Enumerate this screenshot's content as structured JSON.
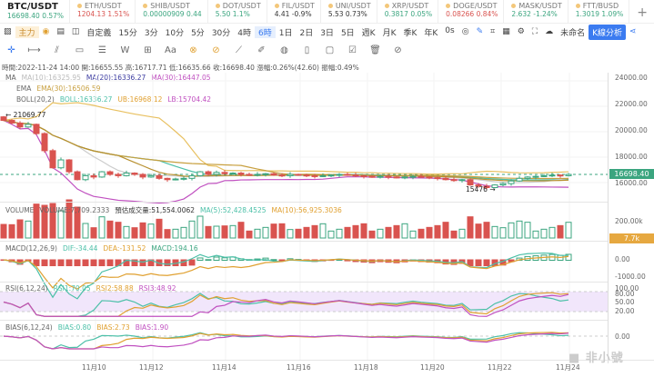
{
  "tickers": [
    {
      "name": "BTC/USDT",
      "price": "16698.40",
      "change": "0.57%",
      "color": "#3ba57f"
    },
    {
      "name": "ETH/USDT",
      "price": "1204.13",
      "change": "1.51%",
      "color": "#d9534f"
    },
    {
      "name": "SHIB/USDT",
      "price": "0.00000909",
      "change": "0.44",
      "color": "#3ba57f"
    },
    {
      "name": "DOT/USDT",
      "price": "5.50",
      "change": "1.1%",
      "color": "#3ba57f"
    },
    {
      "name": "FIL/USDT",
      "price": "4.41",
      "change": "-0.9%",
      "color": "#333"
    },
    {
      "name": "UNI/USDT",
      "price": "5.53",
      "change": "0.73%",
      "color": "#333"
    },
    {
      "name": "XRP/USDT",
      "price": "0.3817",
      "change": "0.05%",
      "color": "#3ba57f"
    },
    {
      "name": "DOGE/USDT",
      "price": "0.08266",
      "change": "0.84%",
      "color": "#d9534f"
    },
    {
      "name": "MASK/USDT",
      "price": "2.632",
      "change": "-1.24%",
      "color": "#3ba57f"
    },
    {
      "name": "FTT/BUSD",
      "price": "1.3019",
      "change": "1.09%",
      "color": "#3ba57f"
    }
  ],
  "toolbar": {
    "main": "主力",
    "custom": "自定義",
    "timeframes": [
      "15分",
      "3分",
      "10分",
      "5分",
      "30分",
      "4時",
      "6時",
      "1日",
      "2日",
      "3日",
      "5日",
      "週K",
      "月K",
      "季K",
      "年K",
      "0s"
    ],
    "active": "6時",
    "layout_name": "未命名",
    "analysis": "K線分析"
  },
  "info": "時間:2022-11-24 14:00 開:16655.55 高:16717.71 低:16635.66 收:16698.40 漲幅:0.26%(42.60) 振幅:0.49%",
  "legend": {
    "ma": {
      "label": "MA",
      "ma10": "MA(10):16325.95",
      "ma20": "MA(20):16336.27",
      "ma30": "MA(30):16447.05"
    },
    "ema": {
      "label": "EMA",
      "ema30": "EMA(30):16506.59"
    },
    "boll": {
      "label": "BOLL(20,2)",
      "boll": "BOLL:16336.27",
      "ub": "UB:16968.12",
      "lb": "LB:15704.42"
    },
    "volume": {
      "label": "VOLUME",
      "vol": "VOLUME:7,709.2333",
      "est": "預估成交量:51,554.0062",
      "ma5": "MA(5):52,428.4525",
      "ma10": "MA(10):56,925.3036"
    },
    "macd": {
      "label": "MACD(12,26,9)",
      "dif": "DIF:-34.44",
      "dea": "DEA:-131.52",
      "macd": "MACD:194.16"
    },
    "rsi": {
      "label": "RSI(6,12,24)",
      "r1": "RSI1:70.05",
      "r2": "RSI2:58.88",
      "r3": "RSI3:48.92"
    },
    "bias": {
      "label": "BIAS(6,12,24)",
      "b1": "BIAS:0.80",
      "b2": "BIAS:2.73",
      "b3": "BIAS:1.90"
    }
  },
  "price_axis": [
    "24000.00",
    "22000.00",
    "20000.00",
    "18000.00",
    "16000.00"
  ],
  "current_price": "16698.40",
  "high_marker": "21069.77",
  "low_marker": "15476",
  "volume_axis": "200.00k",
  "volume_tag": "7.7k",
  "macd_axis": [
    "0.00",
    "-1000.00"
  ],
  "rsi_axis": [
    "100.00",
    "80.00",
    "50.00",
    "20.00"
  ],
  "bias_axis": "0.00",
  "x_labels": [
    "11月10",
    "11月12",
    "11月14",
    "11月16",
    "11月18",
    "11月20",
    "11月22",
    "11月24"
  ],
  "watermark": "非小號",
  "colors": {
    "up": "#3ba57f",
    "down": "#d9534f",
    "accent": "#3b7bf0"
  },
  "chart_data": {
    "type": "candlestick",
    "closes": [
      20800,
      20600,
      20300,
      20500,
      19800,
      18500,
      17200,
      17800,
      16900,
      16300,
      16600,
      16500,
      16900,
      16700,
      16600,
      16800,
      16700,
      16500,
      16600,
      16400,
      16300,
      16350,
      16400,
      16600,
      16900,
      16700,
      16850,
      16750,
      16800,
      16700,
      16650,
      16700,
      16750,
      16650,
      16600,
      16700,
      16650,
      16600,
      16550,
      16600,
      16650,
      16700,
      16650,
      16600,
      16550,
      16500,
      16550,
      16500,
      16450,
      16500,
      16550,
      16500,
      16450,
      16400,
      16300,
      16250,
      16300,
      15900,
      15800,
      15700,
      15900,
      16000,
      16200,
      16400,
      16500,
      16550,
      16600,
      16650,
      16600,
      16698.4
    ]
  }
}
